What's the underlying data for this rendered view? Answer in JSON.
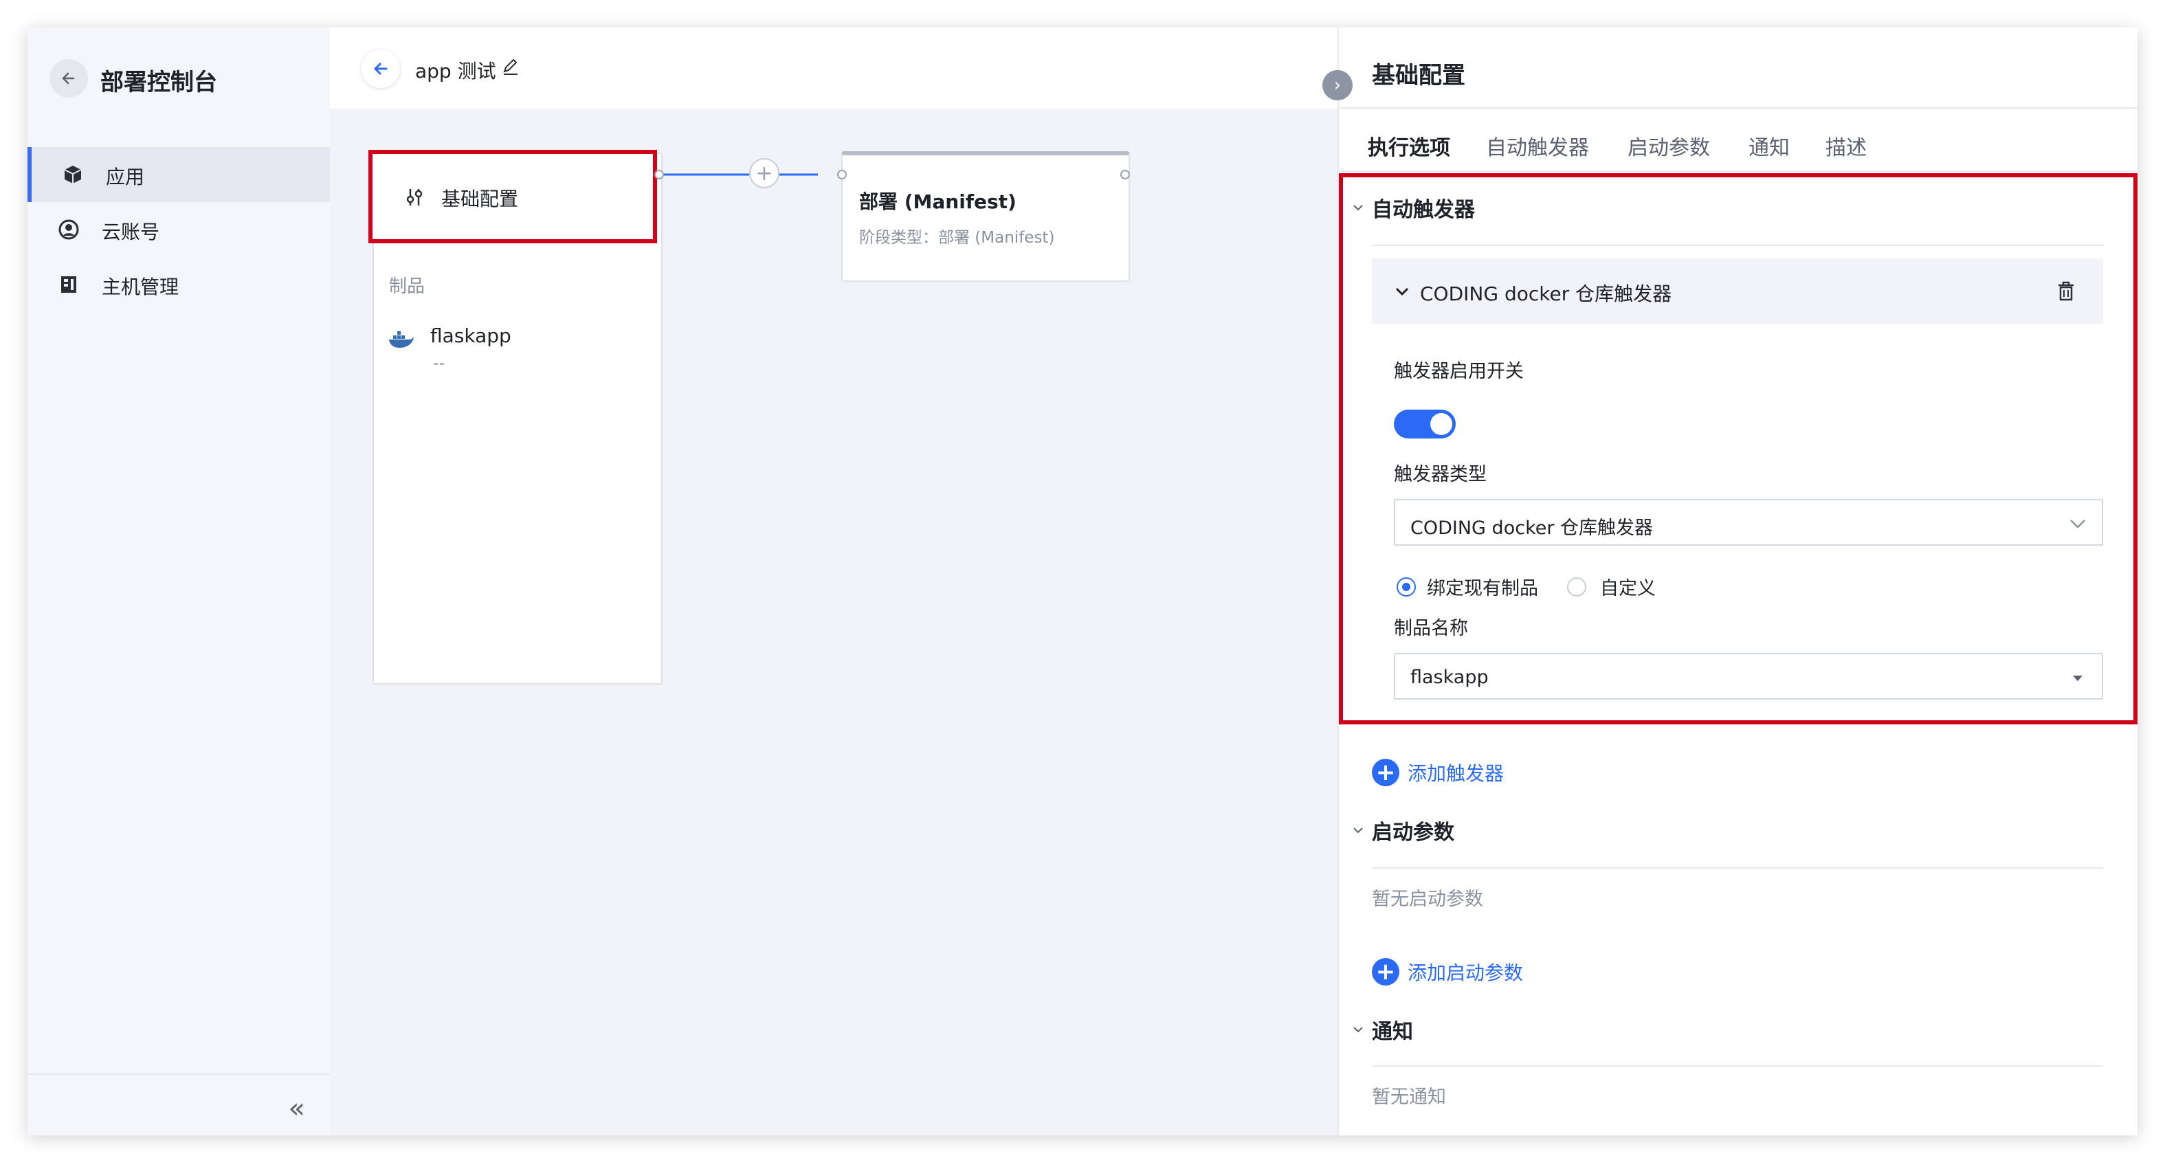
{
  "sidebar": {
    "title": "部署控制台",
    "items": [
      {
        "label": "应用",
        "active": true
      },
      {
        "label": "云账号",
        "active": false
      },
      {
        "label": "主机管理",
        "active": false
      }
    ]
  },
  "canvas": {
    "title": "app 测试",
    "stage_left": {
      "label": "基础配置"
    },
    "artifacts_heading": "制品",
    "artifact": {
      "name": "flaskapp",
      "sub": "--"
    },
    "stage_right": {
      "title": "部署 (Manifest)",
      "subtitle": "阶段类型：部署 (Manifest)"
    }
  },
  "panel": {
    "title": "基础配置",
    "tabs": [
      "执行选项",
      "自动触发器",
      "启动参数",
      "通知",
      "描述"
    ],
    "active_tab": "执行选项",
    "sections": {
      "triggers": {
        "title": "自动触发器",
        "trigger_header": "CODING docker 仓库触发器",
        "switch_label": "触发器启用开关",
        "switch_on": true,
        "type_label": "触发器类型",
        "type_value": "CODING docker 仓库触发器",
        "radio_options": [
          "绑定现有制品",
          "自定义"
        ],
        "radio_selected": "绑定现有制品",
        "artifact_label": "制品名称",
        "artifact_value": "flaskapp",
        "add_label": "添加触发器"
      },
      "params": {
        "title": "启动参数",
        "empty": "暂无启动参数",
        "add_label": "添加启动参数"
      },
      "notify": {
        "title": "通知",
        "empty": "暂无通知"
      }
    }
  },
  "colors": {
    "accent": "#2a6af5",
    "highlight": "#d0021b",
    "sidebar_bg": "#f5f6f9",
    "canvas_bg": "#f1f3f8"
  }
}
